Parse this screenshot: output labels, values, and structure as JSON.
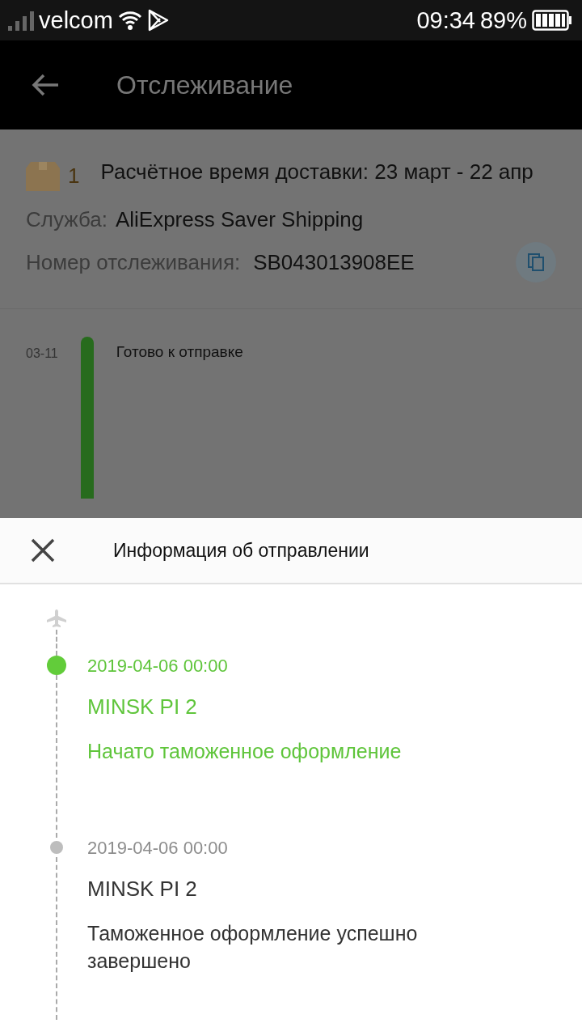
{
  "status_bar": {
    "carrier": "velcom",
    "time": "09:34",
    "battery": "89%"
  },
  "app_bar": {
    "title": "Отслеживание"
  },
  "order": {
    "package_count": "1",
    "delivery_estimate": "Расчётное время доставки: 23 март - 22 апр",
    "service_label": "Служба:",
    "service": "AliExpress Saver Shipping",
    "tracking_label": "Номер отслеживания:",
    "tracking_number": "SB043013908EE"
  },
  "timeline": [
    {
      "date": "03-11",
      "text": "Готово к отправке"
    }
  ],
  "sheet": {
    "title": "Информация об отправлении",
    "events": [
      {
        "datetime": "2019-04-06 00:00",
        "location": "MINSK PI 2",
        "status": "Начато таможенное оформление",
        "current": true
      },
      {
        "datetime": "2019-04-06 00:00",
        "location": "MINSK PI 2",
        "status": "Таможенное оформление успешно завершено",
        "current": false
      }
    ]
  }
}
